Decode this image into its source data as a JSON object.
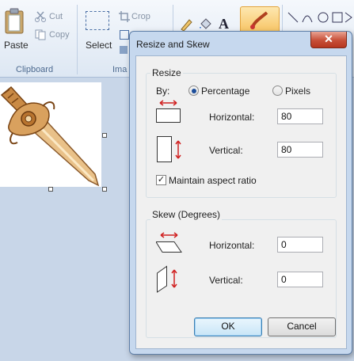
{
  "ribbon": {
    "paste_label": "Paste",
    "cut_label": "Cut",
    "copy_label": "Copy",
    "clipboard_group": "Clipboard",
    "select_label": "Select",
    "crop_label": "Crop",
    "image_group": "Ima"
  },
  "dialog": {
    "title": "Resize and Skew",
    "close_glyph": "✕",
    "resize": {
      "legend": "Resize",
      "by_label": "By:",
      "percentage_label": "Percentage",
      "pixels_label": "Pixels",
      "selected_unit": "Percentage",
      "horizontal_label": "Horizontal:",
      "horizontal_value": "80",
      "vertical_label": "Vertical:",
      "vertical_value": "80",
      "maintain_label": "Maintain aspect ratio",
      "maintain_checked": true
    },
    "skew": {
      "legend": "Skew (Degrees)",
      "horizontal_label": "Horizontal:",
      "horizontal_value": "0",
      "vertical_label": "Vertical:",
      "vertical_value": "0"
    },
    "ok_label": "OK",
    "cancel_label": "Cancel"
  },
  "colors": {
    "arrow_red": "#d02020",
    "accent_blue": "#1d4e9a"
  }
}
